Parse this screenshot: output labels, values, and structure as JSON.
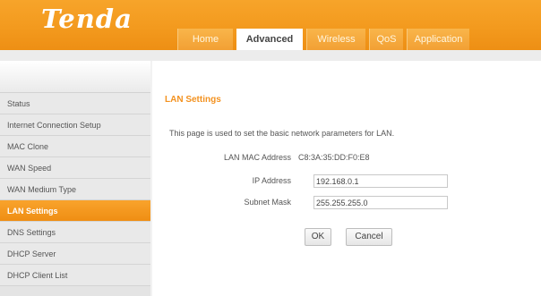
{
  "header": {
    "logo": "Tenda",
    "tabs": [
      {
        "label": "Home"
      },
      {
        "label": "Advanced"
      },
      {
        "label": "Wireless"
      },
      {
        "label": "QoS"
      },
      {
        "label": "Application"
      }
    ],
    "active_tab": "Advanced",
    "accent_color": "#f39a1e"
  },
  "sidebar": {
    "items": [
      {
        "label": "Status"
      },
      {
        "label": "Internet Connection Setup"
      },
      {
        "label": "MAC Clone"
      },
      {
        "label": "WAN Speed"
      },
      {
        "label": "WAN Medium Type"
      },
      {
        "label": "LAN Settings"
      },
      {
        "label": "DNS Settings"
      },
      {
        "label": "DHCP Server"
      },
      {
        "label": "DHCP Client List"
      }
    ],
    "active_item": "LAN Settings"
  },
  "main": {
    "title": "LAN Settings",
    "description": "This page is used to set the basic network parameters for LAN.",
    "mac_label": "LAN MAC Address",
    "mac_value": "C8:3A:35:DD:F0:E8",
    "ip_label": "IP Address",
    "ip_value": "192.168.0.1",
    "mask_label": "Subnet Mask",
    "mask_value": "255.255.255.0",
    "ok_label": "OK",
    "cancel_label": "Cancel"
  }
}
